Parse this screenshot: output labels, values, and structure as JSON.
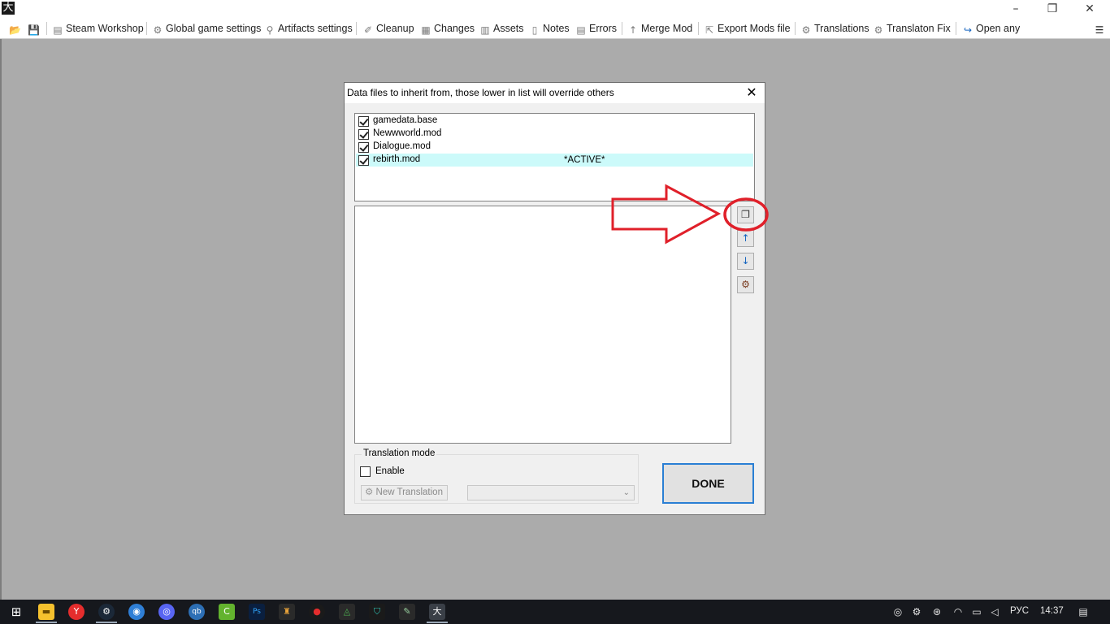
{
  "window": {
    "app_icon": "大",
    "minimize_icon": "–",
    "restore_icon": "❐",
    "close_icon": "✕"
  },
  "toolbar": {
    "items": [
      {
        "label": "Steam Workshop",
        "icon": "workshop-icon"
      },
      {
        "label": "Global game settings",
        "icon": "gear-icon"
      },
      {
        "label": "Artifacts settings",
        "icon": "artifact-icon"
      },
      {
        "label": "Cleanup",
        "icon": "broom-icon"
      },
      {
        "label": "Changes",
        "icon": "changes-icon"
      },
      {
        "label": "Assets",
        "icon": "assets-icon"
      },
      {
        "label": "Notes",
        "icon": "notes-icon"
      },
      {
        "label": "Errors",
        "icon": "errors-icon"
      },
      {
        "label": "Merge Mod",
        "icon": "merge-arrow-icon"
      },
      {
        "label": "Export Mods file",
        "icon": "export-icon"
      },
      {
        "label": "Translations",
        "icon": "translations-icon"
      },
      {
        "label": "Translaton Fix",
        "icon": "translation-fix-icon"
      },
      {
        "label": "Open any",
        "icon": "open-any-icon"
      }
    ]
  },
  "dialog": {
    "title": "Data files to inherit from, those lower in list will override others",
    "close_label": "✕",
    "mods": [
      {
        "name": "gamedata.base",
        "checked": true,
        "status": ""
      },
      {
        "name": "Newwworld.mod",
        "checked": true,
        "status": ""
      },
      {
        "name": "Dialogue.mod",
        "checked": true,
        "status": ""
      },
      {
        "name": "rebirth.mod",
        "checked": true,
        "status": "*ACTIVE*"
      }
    ],
    "side_buttons": [
      {
        "icon": "add-file-icon"
      },
      {
        "icon": "arrow-up-icon"
      },
      {
        "icon": "arrow-down-icon"
      },
      {
        "icon": "settings-icon"
      }
    ],
    "translation_group": {
      "legend": "Translation mode",
      "enable_label": "Enable",
      "enabled": false,
      "new_translation_label": "New Translation",
      "language_value": ""
    },
    "done_label": "DONE"
  },
  "annotation": {
    "arrow_color": "#e0202a",
    "circle_color": "#e0202a"
  },
  "taskbar": {
    "tray": {
      "language": "РУС",
      "time": "14:37"
    }
  }
}
